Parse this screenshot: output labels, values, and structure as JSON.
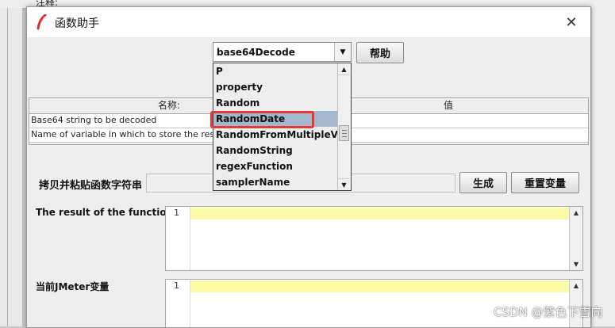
{
  "background": {
    "partial_label": "注释:"
  },
  "dialog": {
    "title": "函数助手",
    "close_glyph": "✕"
  },
  "function_select": {
    "value": "base64Decode",
    "options": [
      "P",
      "property",
      "Random",
      "RandomDate",
      "RandomFromMultipleVars",
      "RandomString",
      "regexFunction",
      "samplerName"
    ],
    "selected": "RandomDate"
  },
  "help_button": {
    "label": "帮助"
  },
  "params_table": {
    "columns": [
      "名称:",
      "值"
    ],
    "rows": [
      {
        "name": "Base64 string to be decoded",
        "value": ""
      },
      {
        "name": "Name of variable in which to store the result (optional)",
        "value": ""
      }
    ]
  },
  "copy_section": {
    "label": "拷贝并粘贴函数字符串",
    "value": "",
    "generate_label": "生成",
    "reset_label": "重置变量"
  },
  "result_section": {
    "label": "The result of the function is",
    "line_number": "1"
  },
  "vars_section": {
    "label": "当前JMeter变量",
    "line_number": "1"
  },
  "watermark": "CSDN @紫色下雪向",
  "colors": {
    "highlight_box": "#e53935",
    "selected_item": "#a3b8cc",
    "editor_current_line": "#fdfca6"
  },
  "icons": [
    "feather-icon",
    "close-icon",
    "chevron-down-icon",
    "chevron-up-icon"
  ]
}
